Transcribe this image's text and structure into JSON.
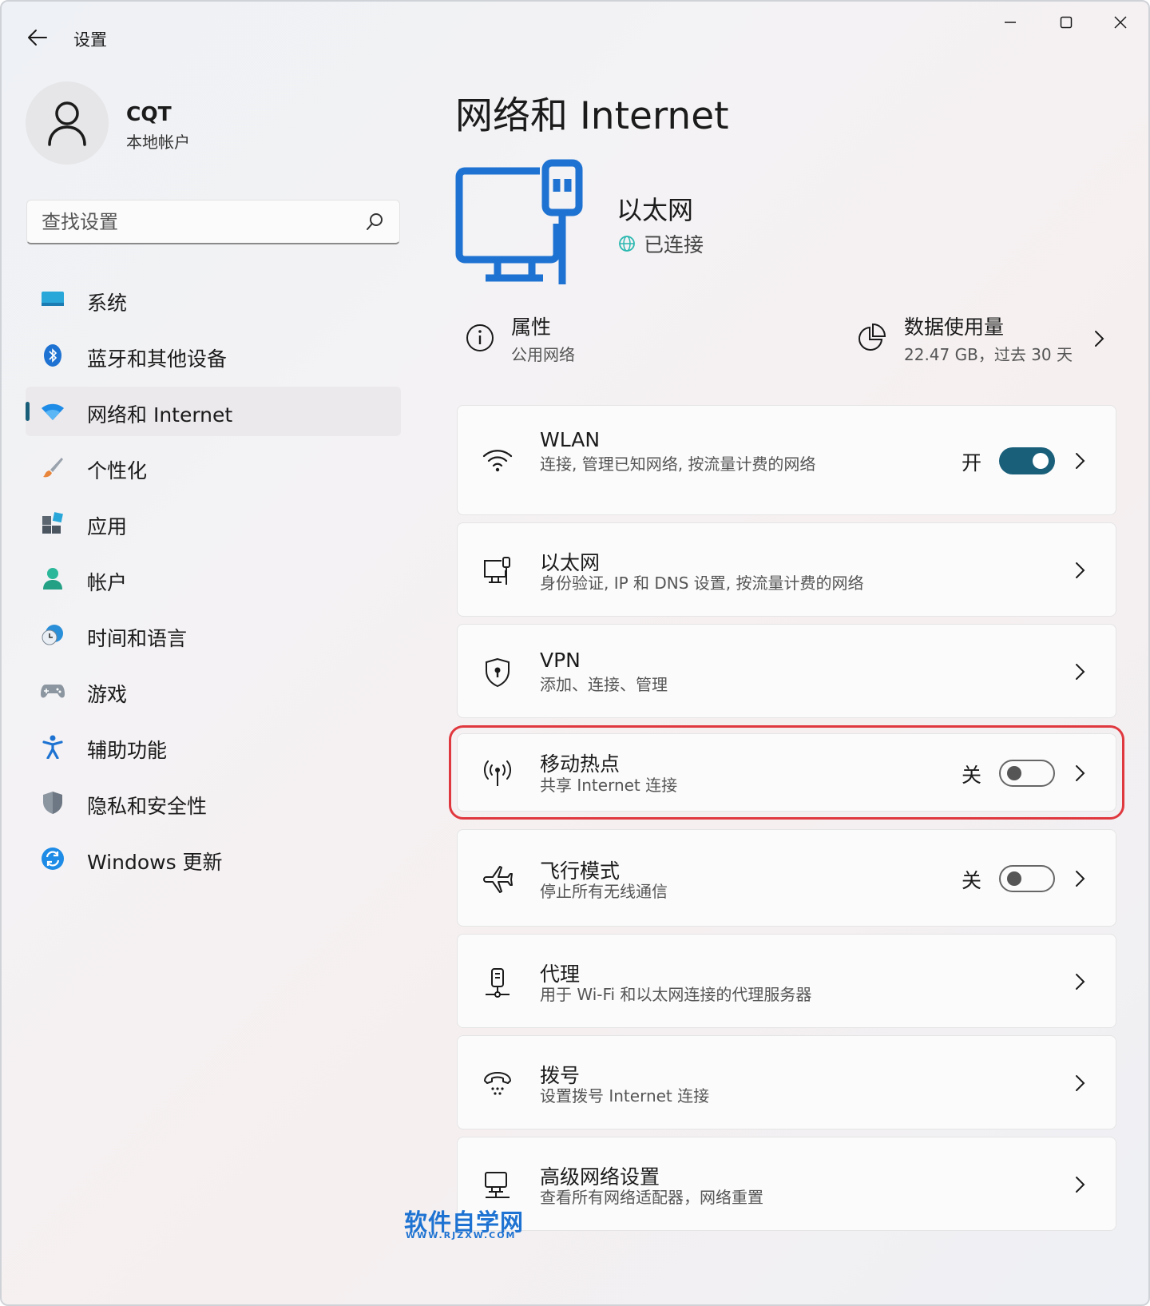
{
  "window": {
    "title": "设置"
  },
  "profile": {
    "name": "CQT",
    "account_type": "本地帐户"
  },
  "search": {
    "placeholder": "查找设置"
  },
  "sidebar": {
    "items": [
      {
        "label": "系统",
        "icon": "system-icon"
      },
      {
        "label": "蓝牙和其他设备",
        "icon": "bluetooth-icon"
      },
      {
        "label": "网络和 Internet",
        "icon": "network-icon",
        "active": true
      },
      {
        "label": "个性化",
        "icon": "brush-icon"
      },
      {
        "label": "应用",
        "icon": "apps-icon"
      },
      {
        "label": "帐户",
        "icon": "account-icon"
      },
      {
        "label": "时间和语言",
        "icon": "time-language-icon"
      },
      {
        "label": "游戏",
        "icon": "gamepad-icon"
      },
      {
        "label": "辅助功能",
        "icon": "accessibility-icon"
      },
      {
        "label": "隐私和安全性",
        "icon": "shield-icon"
      },
      {
        "label": "Windows 更新",
        "icon": "update-icon"
      }
    ]
  },
  "main": {
    "title": "网络和 Internet",
    "connection": {
      "name": "以太网",
      "status": "已连接"
    },
    "properties": {
      "title": "属性",
      "subtitle": "公用网络"
    },
    "data_usage": {
      "title": "数据使用量",
      "subtitle": "22.47 GB，过去 30 天"
    },
    "cards": [
      {
        "title": "WLAN",
        "subtitle": "连接, 管理已知网络, 按流量计费的网络",
        "icon": "wifi-icon",
        "toggle": {
          "label": "开",
          "on": true
        }
      },
      {
        "title": "以太网",
        "subtitle": "身份验证, IP 和 DNS 设置, 按流量计费的网络",
        "icon": "ethernet-icon"
      },
      {
        "title": "VPN",
        "subtitle": "添加、连接、管理",
        "icon": "vpn-shield-icon"
      },
      {
        "title": "移动热点",
        "subtitle": "共享 Internet 连接",
        "icon": "hotspot-icon",
        "toggle": {
          "label": "关",
          "on": false
        },
        "highlighted": true
      },
      {
        "title": "飞行模式",
        "subtitle": "停止所有无线通信",
        "icon": "airplane-icon",
        "toggle": {
          "label": "关",
          "on": false
        }
      },
      {
        "title": "代理",
        "subtitle": "用于 Wi-Fi 和以太网连接的代理服务器",
        "icon": "proxy-icon"
      },
      {
        "title": "拨号",
        "subtitle": "设置拨号 Internet 连接",
        "icon": "dialup-icon"
      },
      {
        "title": "高级网络设置",
        "subtitle": "查看所有网络适配器，网络重置",
        "icon": "advanced-network-icon"
      }
    ]
  },
  "watermark": {
    "text": "软件自学网",
    "url": "WWW.RJZXW.COM"
  },
  "colors": {
    "accent": "#1a5f7a",
    "highlight_border": "#e0383f",
    "watermark": "#1e73d2"
  }
}
